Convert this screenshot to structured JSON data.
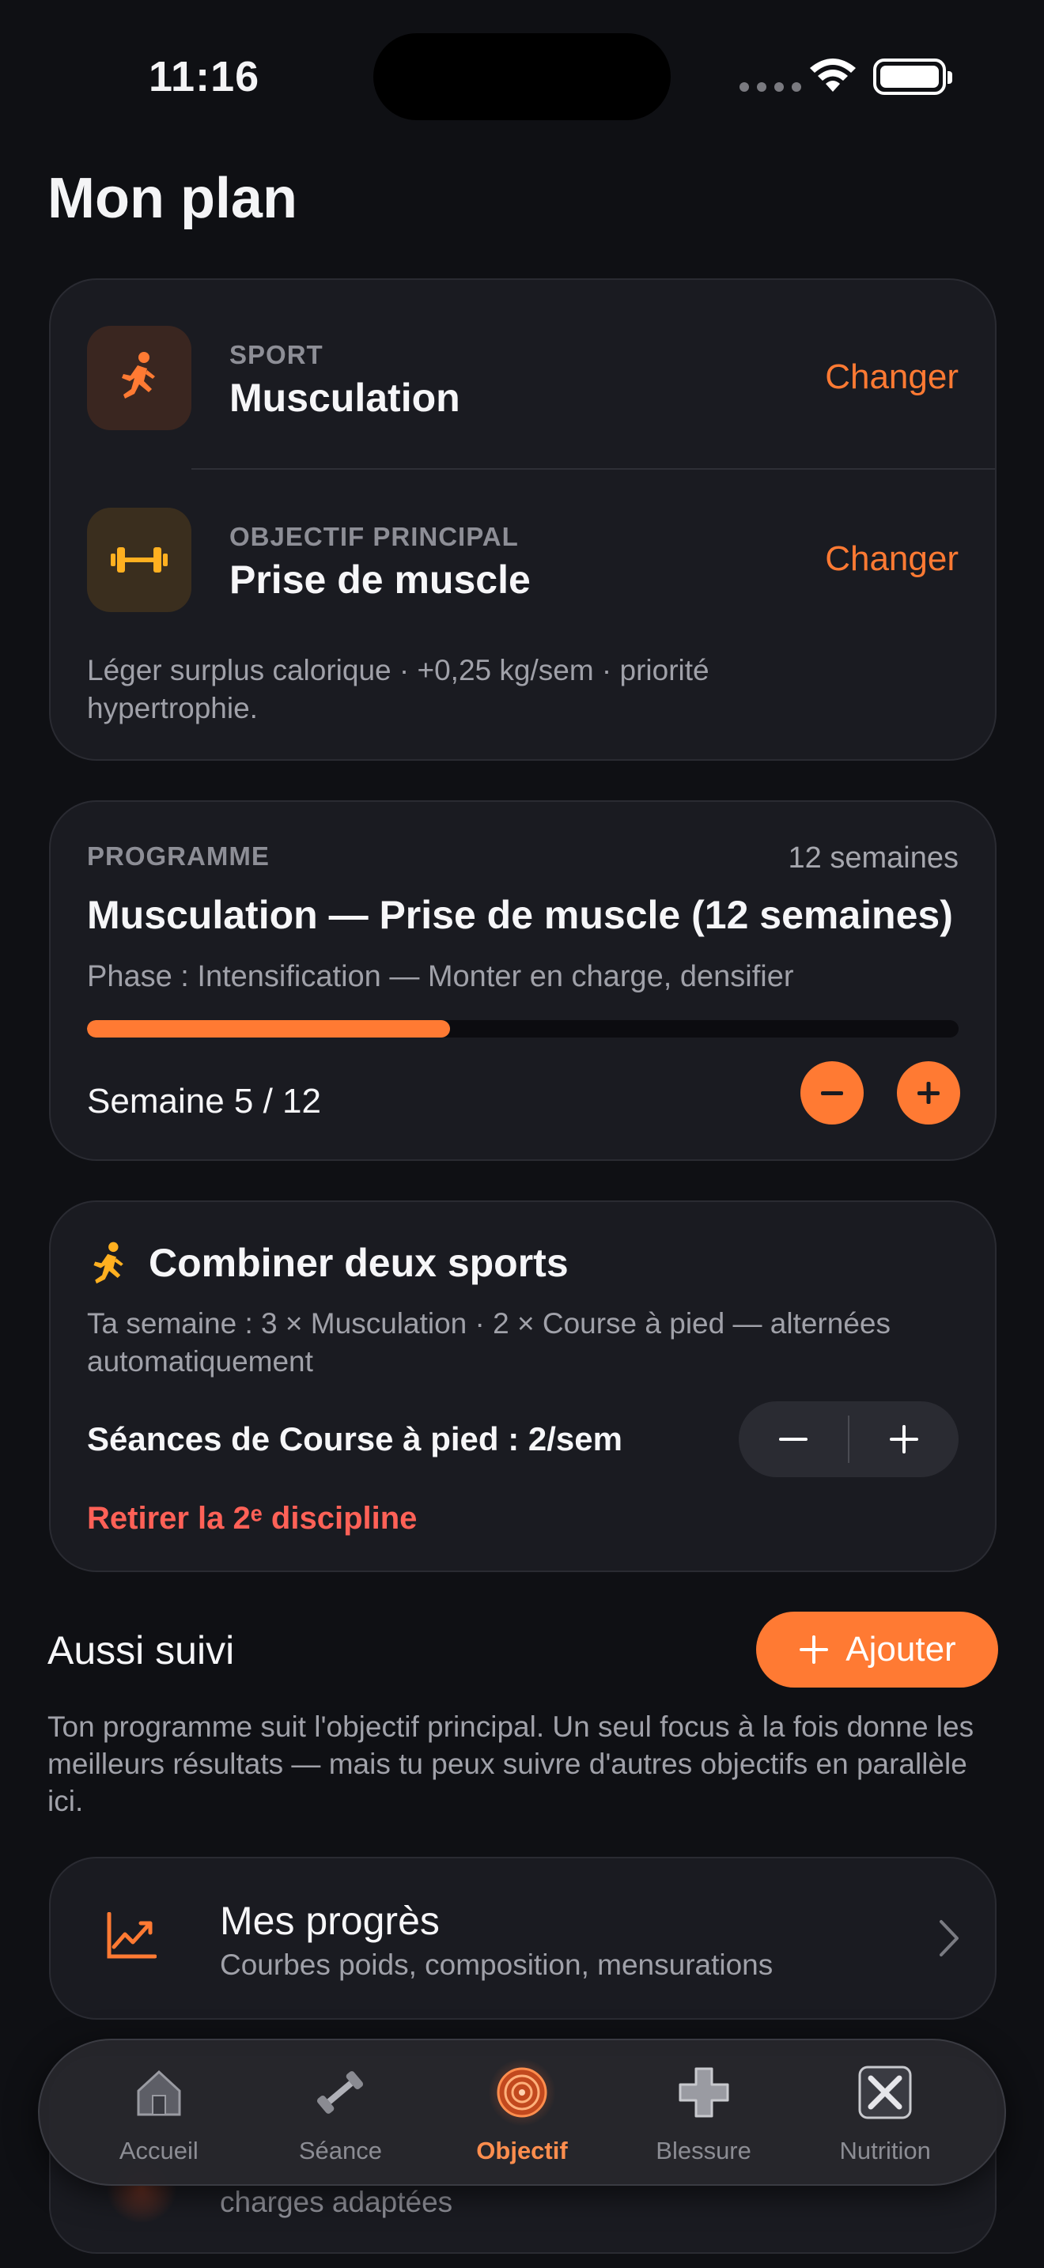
{
  "status_bar": {
    "time": "11:16"
  },
  "page_title": "Mon plan",
  "plan_card": {
    "sport_label": "SPORT",
    "sport_value": "Musculation",
    "sport_change": "Changer",
    "goal_label": "OBJECTIF PRINCIPAL",
    "goal_value": "Prise de muscle",
    "goal_change": "Changer",
    "goal_description": "Léger surplus calorique · +0,25 kg/sem · priorité hypertrophie."
  },
  "program_card": {
    "label": "PROGRAMME",
    "duration": "12 semaines",
    "title": "Musculation — Prise de muscle (12 semaines)",
    "phase": "Phase : Intensification — Monter en charge, densifier",
    "progress": 0.4167,
    "week": "Semaine 5 / 12"
  },
  "combine_card": {
    "title": "Combiner deux sports",
    "description": "Ta semaine : 3 × Musculation · 2 × Course à pied — alternées automatiquement",
    "sessions": "Séances de Course à pied : 2/sem",
    "remove": "Retirer la 2ᵉ discipline"
  },
  "also_followed": {
    "title": "Aussi suivi",
    "add_label": "Ajouter",
    "description": "Ton programme suit l'objectif principal. Un seul focus à la fois donne les meilleurs résultats — mais tu peux suivre d'autres objectifs en parallèle ici."
  },
  "progress_row": {
    "title": "Mes progrès",
    "subtitle": "Courbes poids, composition, mensurations"
  },
  "partial_row": {
    "subtitle": "charges adaptées"
  },
  "tabbar": {
    "tabs": [
      {
        "label": "Accueil",
        "icon": "home-icon"
      },
      {
        "label": "Séance",
        "icon": "dumbbell-icon"
      },
      {
        "label": "Objectif",
        "icon": "target-icon",
        "active": true
      },
      {
        "label": "Blessure",
        "icon": "medical-cross-icon"
      },
      {
        "label": "Nutrition",
        "icon": "utensils-icon"
      }
    ]
  },
  "colors": {
    "accent": "#ff7a33",
    "danger": "#ff6157",
    "background": "#0f1014",
    "card": "#1a1b21"
  }
}
